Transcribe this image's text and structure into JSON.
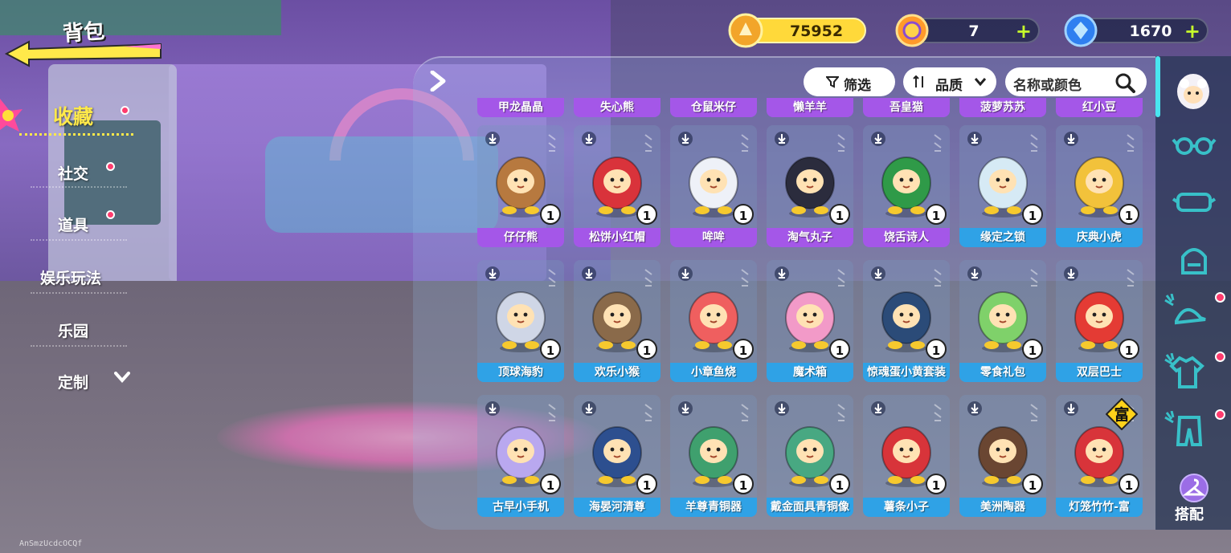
{
  "header": {
    "title": "背包"
  },
  "menu": {
    "items": [
      {
        "label": "收藏",
        "active": true,
        "dot": true
      },
      {
        "label": "社交",
        "active": false,
        "dot": true
      },
      {
        "label": "道具",
        "active": false,
        "dot": true
      },
      {
        "label": "娱乐玩法",
        "active": false,
        "dot": false
      },
      {
        "label": "乐园",
        "active": false,
        "dot": false
      },
      {
        "label": "定制",
        "active": false,
        "dot": false
      }
    ]
  },
  "currency": {
    "gold": "75952",
    "tickets": "7",
    "gems": "1670",
    "plus": "+"
  },
  "toolbar": {
    "filter_label": "筛选",
    "sort_label": "品质",
    "search_placeholder": "名称或颜色"
  },
  "grid": {
    "top_row": [
      "甲龙晶晶",
      "失心熊",
      "仓鼠米仔",
      "懒羊羊",
      "吾皇猫",
      "菠萝苏苏",
      "红小豆"
    ],
    "row1": [
      {
        "name": "仔仔熊",
        "count": "1",
        "color": "#b7793f",
        "rarity": "purple"
      },
      {
        "name": "松饼小红帽",
        "count": "1",
        "color": "#d9333b",
        "rarity": "purple"
      },
      {
        "name": "哞哞",
        "count": "1",
        "color": "#eef1f8",
        "rarity": "purple"
      },
      {
        "name": "淘气丸子",
        "count": "1",
        "color": "#2b2c3d",
        "rarity": "purple"
      },
      {
        "name": "饶舌诗人",
        "count": "1",
        "color": "#2f9a48",
        "rarity": "purple"
      },
      {
        "name": "缘定之锁",
        "count": "1",
        "color": "#d6eaf5",
        "rarity": "blue"
      },
      {
        "name": "庆典小虎",
        "count": "1",
        "color": "#f2c23b",
        "rarity": "blue"
      }
    ],
    "row2": [
      {
        "name": "顶球海豹",
        "count": "1",
        "color": "#cfd6e6",
        "rarity": "blue"
      },
      {
        "name": "欢乐小猴",
        "count": "1",
        "color": "#8a6a4a",
        "rarity": "blue"
      },
      {
        "name": "小章鱼烧",
        "count": "1",
        "color": "#ef5f5f",
        "rarity": "blue"
      },
      {
        "name": "魔术箱",
        "count": "1",
        "color": "#f29ac8",
        "rarity": "blue"
      },
      {
        "name": "惊魂蛋小黄套装",
        "count": "1",
        "color": "#2b4b78",
        "rarity": "blue"
      },
      {
        "name": "零食礼包",
        "count": "1",
        "color": "#7fd16a",
        "rarity": "blue"
      },
      {
        "name": "双层巴士",
        "count": "1",
        "color": "#e43b34",
        "rarity": "blue"
      }
    ],
    "row3": [
      {
        "name": "古早小手机",
        "count": "1",
        "color": "#b9a8ef",
        "rarity": "blue"
      },
      {
        "name": "海晏河清尊",
        "count": "1",
        "color": "#2d4f8f",
        "rarity": "blue"
      },
      {
        "name": "羊尊青铜器",
        "count": "1",
        "color": "#3fa06e",
        "rarity": "blue"
      },
      {
        "name": "戴金面具青铜像",
        "count": "1",
        "color": "#48a882",
        "rarity": "blue"
      },
      {
        "name": "薯条小子",
        "count": "1",
        "color": "#d8343a",
        "rarity": "blue"
      },
      {
        "name": "美洲陶器",
        "count": "1",
        "color": "#6a4632",
        "rarity": "blue"
      },
      {
        "name": "灯笼竹竹-富",
        "count": "1",
        "color": "#d8343a",
        "rarity": "blue",
        "badge": "富"
      }
    ]
  },
  "sidebar": {
    "tabs": [
      "avatar-tab",
      "glasses-tab",
      "face-accessory-tab",
      "backpack-tab",
      "hat-tab",
      "top-clothes-tab",
      "pants-tab"
    ],
    "dress_label": "搭配"
  },
  "watermark": "AnSmzUcdcOCQf"
}
